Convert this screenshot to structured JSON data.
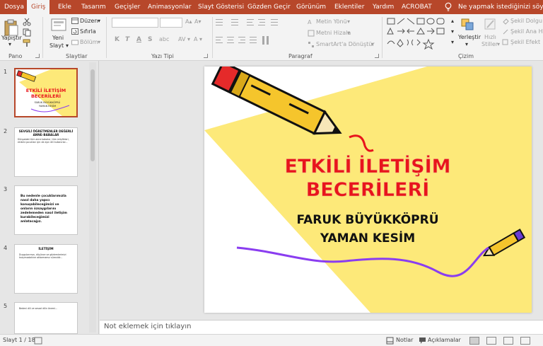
{
  "tabs": [
    {
      "label": "Dosya",
      "active": false
    },
    {
      "label": "Giriş",
      "active": true
    },
    {
      "label": "Ekle",
      "active": false
    },
    {
      "label": "Tasarım",
      "active": false
    },
    {
      "label": "Geçişler",
      "active": false
    },
    {
      "label": "Animasyonlar",
      "active": false
    },
    {
      "label": "Slayt Gösterisi",
      "active": false
    },
    {
      "label": "Gözden Geçir",
      "active": false
    },
    {
      "label": "Görünüm",
      "active": false
    },
    {
      "label": "Eklentiler",
      "active": false
    },
    {
      "label": "Yardım",
      "active": false
    },
    {
      "label": "ACROBAT",
      "active": false
    }
  ],
  "tell_me": "Ne yapmak istediğinizi söyleyin",
  "ribbon": {
    "pano": {
      "label": "Pano",
      "paste": "Yapıştır"
    },
    "slaytlar": {
      "label": "Slaytlar",
      "new_slide_1": "Yeni",
      "new_slide_2": "Slayt",
      "layout": "Düzen",
      "reset": "Sıfırla",
      "section": "Bölüm"
    },
    "yazi_tipi": {
      "label": "Yazı Tipi",
      "bold": "K",
      "italic": "T",
      "underline": "A",
      "strike": "S",
      "spacing": "abc"
    },
    "paragraf": {
      "label": "Paragraf",
      "text_direction": "Metin Yönü",
      "align_text": "Metni Hizala",
      "smartart": "SmartArt'a Dönüştür"
    },
    "cizim": {
      "label": "Çizim",
      "arrange": "Yerleştir",
      "quick_styles_1": "Hızlı",
      "quick_styles_2": "Stiller",
      "shape_fill": "Şekil Dolgu",
      "shape_outline": "Şekil Ana Hat",
      "shape_effects": "Şekil Efekt"
    }
  },
  "thumbnails": [
    {
      "num": "1",
      "title": "ETKİLİ İLETİŞİM BECERİLERİ",
      "sub": "FARUK BÜYÜKKÖPRÜ YAMAN KESİM"
    },
    {
      "num": "2",
      "title": "SEVGİLİ ÖĞRETMENLER DEĞERLİ ANNE-BABALAR",
      "body": "Dünyadaki tüm anne babalar, tüm müşfikleri, ekibini çocukları için de aynı dili kullanırlar..."
    },
    {
      "num": "3",
      "title": "",
      "body": "Bu nedenle çocuklarımızla nasıl daha yapıcı konuşabileceğimizi ve onların özsaygılarını zedelemeden nasıl iletişim kurabileceğimizi anlatacağız."
    },
    {
      "num": "4",
      "title": "İLETİŞİM",
      "body": "Duygularımızı, düşünce ve gözlemlerimizi karşımızdakine aktarmamız sürecidir..."
    },
    {
      "num": "5",
      "title": "",
      "body": "Bedeni dili ve sessel dilin önemi..."
    }
  ],
  "slide": {
    "title_line1": "ETKİLİ İLETİŞİM",
    "title_line2": "BECERİLERİ",
    "author1": "FARUK  BÜYÜKKÖPRÜ",
    "author2": "YAMAN KESİM"
  },
  "notes_placeholder": "Not eklemek için tıklayın",
  "status": {
    "slide_counter": "Slayt 1 / 18",
    "notes_label": "Notlar",
    "comments_label": "Açıklamalar"
  },
  "colors": {
    "ribbon_accent": "#b7472a",
    "slide_title": "#e8141c",
    "yellow_shape": "#fde979",
    "purple_squiggle": "#8a3df0"
  }
}
